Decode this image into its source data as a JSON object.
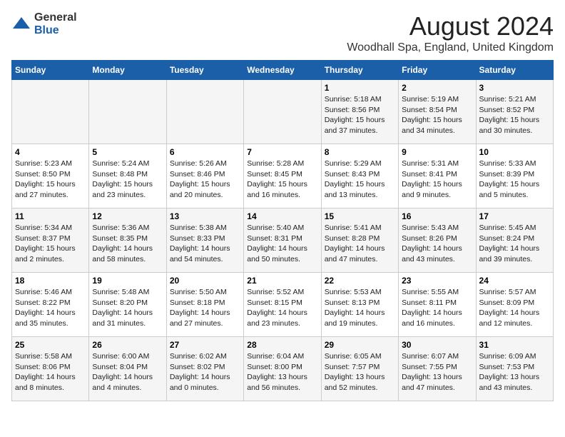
{
  "logo": {
    "general": "General",
    "blue": "Blue"
  },
  "title": "August 2024",
  "subtitle": "Woodhall Spa, England, United Kingdom",
  "days_of_week": [
    "Sunday",
    "Monday",
    "Tuesday",
    "Wednesday",
    "Thursday",
    "Friday",
    "Saturday"
  ],
  "weeks": [
    [
      {
        "day": "",
        "info": ""
      },
      {
        "day": "",
        "info": ""
      },
      {
        "day": "",
        "info": ""
      },
      {
        "day": "",
        "info": ""
      },
      {
        "day": "1",
        "info": "Sunrise: 5:18 AM\nSunset: 8:56 PM\nDaylight: 15 hours\nand 37 minutes."
      },
      {
        "day": "2",
        "info": "Sunrise: 5:19 AM\nSunset: 8:54 PM\nDaylight: 15 hours\nand 34 minutes."
      },
      {
        "day": "3",
        "info": "Sunrise: 5:21 AM\nSunset: 8:52 PM\nDaylight: 15 hours\nand 30 minutes."
      }
    ],
    [
      {
        "day": "4",
        "info": "Sunrise: 5:23 AM\nSunset: 8:50 PM\nDaylight: 15 hours\nand 27 minutes."
      },
      {
        "day": "5",
        "info": "Sunrise: 5:24 AM\nSunset: 8:48 PM\nDaylight: 15 hours\nand 23 minutes."
      },
      {
        "day": "6",
        "info": "Sunrise: 5:26 AM\nSunset: 8:46 PM\nDaylight: 15 hours\nand 20 minutes."
      },
      {
        "day": "7",
        "info": "Sunrise: 5:28 AM\nSunset: 8:45 PM\nDaylight: 15 hours\nand 16 minutes."
      },
      {
        "day": "8",
        "info": "Sunrise: 5:29 AM\nSunset: 8:43 PM\nDaylight: 15 hours\nand 13 minutes."
      },
      {
        "day": "9",
        "info": "Sunrise: 5:31 AM\nSunset: 8:41 PM\nDaylight: 15 hours\nand 9 minutes."
      },
      {
        "day": "10",
        "info": "Sunrise: 5:33 AM\nSunset: 8:39 PM\nDaylight: 15 hours\nand 5 minutes."
      }
    ],
    [
      {
        "day": "11",
        "info": "Sunrise: 5:34 AM\nSunset: 8:37 PM\nDaylight: 15 hours\nand 2 minutes."
      },
      {
        "day": "12",
        "info": "Sunrise: 5:36 AM\nSunset: 8:35 PM\nDaylight: 14 hours\nand 58 minutes."
      },
      {
        "day": "13",
        "info": "Sunrise: 5:38 AM\nSunset: 8:33 PM\nDaylight: 14 hours\nand 54 minutes."
      },
      {
        "day": "14",
        "info": "Sunrise: 5:40 AM\nSunset: 8:31 PM\nDaylight: 14 hours\nand 50 minutes."
      },
      {
        "day": "15",
        "info": "Sunrise: 5:41 AM\nSunset: 8:28 PM\nDaylight: 14 hours\nand 47 minutes."
      },
      {
        "day": "16",
        "info": "Sunrise: 5:43 AM\nSunset: 8:26 PM\nDaylight: 14 hours\nand 43 minutes."
      },
      {
        "day": "17",
        "info": "Sunrise: 5:45 AM\nSunset: 8:24 PM\nDaylight: 14 hours\nand 39 minutes."
      }
    ],
    [
      {
        "day": "18",
        "info": "Sunrise: 5:46 AM\nSunset: 8:22 PM\nDaylight: 14 hours\nand 35 minutes."
      },
      {
        "day": "19",
        "info": "Sunrise: 5:48 AM\nSunset: 8:20 PM\nDaylight: 14 hours\nand 31 minutes."
      },
      {
        "day": "20",
        "info": "Sunrise: 5:50 AM\nSunset: 8:18 PM\nDaylight: 14 hours\nand 27 minutes."
      },
      {
        "day": "21",
        "info": "Sunrise: 5:52 AM\nSunset: 8:15 PM\nDaylight: 14 hours\nand 23 minutes."
      },
      {
        "day": "22",
        "info": "Sunrise: 5:53 AM\nSunset: 8:13 PM\nDaylight: 14 hours\nand 19 minutes."
      },
      {
        "day": "23",
        "info": "Sunrise: 5:55 AM\nSunset: 8:11 PM\nDaylight: 14 hours\nand 16 minutes."
      },
      {
        "day": "24",
        "info": "Sunrise: 5:57 AM\nSunset: 8:09 PM\nDaylight: 14 hours\nand 12 minutes."
      }
    ],
    [
      {
        "day": "25",
        "info": "Sunrise: 5:58 AM\nSunset: 8:06 PM\nDaylight: 14 hours\nand 8 minutes."
      },
      {
        "day": "26",
        "info": "Sunrise: 6:00 AM\nSunset: 8:04 PM\nDaylight: 14 hours\nand 4 minutes."
      },
      {
        "day": "27",
        "info": "Sunrise: 6:02 AM\nSunset: 8:02 PM\nDaylight: 14 hours\nand 0 minutes."
      },
      {
        "day": "28",
        "info": "Sunrise: 6:04 AM\nSunset: 8:00 PM\nDaylight: 13 hours\nand 56 minutes."
      },
      {
        "day": "29",
        "info": "Sunrise: 6:05 AM\nSunset: 7:57 PM\nDaylight: 13 hours\nand 52 minutes."
      },
      {
        "day": "30",
        "info": "Sunrise: 6:07 AM\nSunset: 7:55 PM\nDaylight: 13 hours\nand 47 minutes."
      },
      {
        "day": "31",
        "info": "Sunrise: 6:09 AM\nSunset: 7:53 PM\nDaylight: 13 hours\nand 43 minutes."
      }
    ]
  ]
}
